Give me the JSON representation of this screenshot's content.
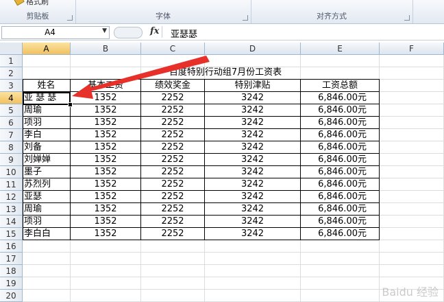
{
  "ribbon": {
    "format_painter_label": "格式刷",
    "groups": [
      {
        "label": "剪贴板"
      },
      {
        "label": "字体"
      },
      {
        "label": "对齐方式"
      }
    ]
  },
  "formula_bar": {
    "name_box": "A4",
    "fx_label": "fx",
    "content": "亚瑟瑟"
  },
  "columns": [
    "A",
    "B",
    "C",
    "D",
    "E",
    "F"
  ],
  "rows": [
    "1",
    "2",
    "3",
    "4",
    "5",
    "6",
    "7",
    "8",
    "9",
    "10",
    "11",
    "12",
    "13",
    "14",
    "15",
    "16",
    "17",
    "18",
    "19",
    "20"
  ],
  "sheet": {
    "title": "百度特别行动组7月份工资表",
    "headers": [
      "姓名",
      "基本工资",
      "绩效奖金",
      "特别津贴",
      "工资总额"
    ],
    "records": [
      [
        "亚 瑟 瑟",
        "1352",
        "2252",
        "3242",
        "6,846.00元"
      ],
      [
        "周瑜",
        "1352",
        "2252",
        "3242",
        "6,846.00元"
      ],
      [
        "项羽",
        "1352",
        "2252",
        "3242",
        "6,846.00元"
      ],
      [
        "李白",
        "1352",
        "2252",
        "3242",
        "6,846.00元"
      ],
      [
        "刘备",
        "1352",
        "2252",
        "3242",
        "6,846.00元"
      ],
      [
        "刘婵婵",
        "1352",
        "2252",
        "3242",
        "6,846.00元"
      ],
      [
        "墨子",
        "1352",
        "2252",
        "3242",
        "6,846.00元"
      ],
      [
        "苏烈列",
        "1352",
        "2252",
        "3242",
        "6,846.00元"
      ],
      [
        "亚瑟",
        "1352",
        "2252",
        "3242",
        "6,846.00元"
      ],
      [
        "周瑜",
        "1352",
        "2252",
        "3242",
        "6,846.00元"
      ],
      [
        "项羽",
        "1352",
        "2252",
        "3242",
        "6,846.00元"
      ],
      [
        "李白白",
        "1352",
        "2252",
        "3242",
        "6,846.00元"
      ]
    ]
  },
  "selected_cell": "A4",
  "colors": {
    "annotation_arrow": "#e8302a",
    "selection_header": "#f1c15f"
  },
  "watermark": "Baidu 经验"
}
